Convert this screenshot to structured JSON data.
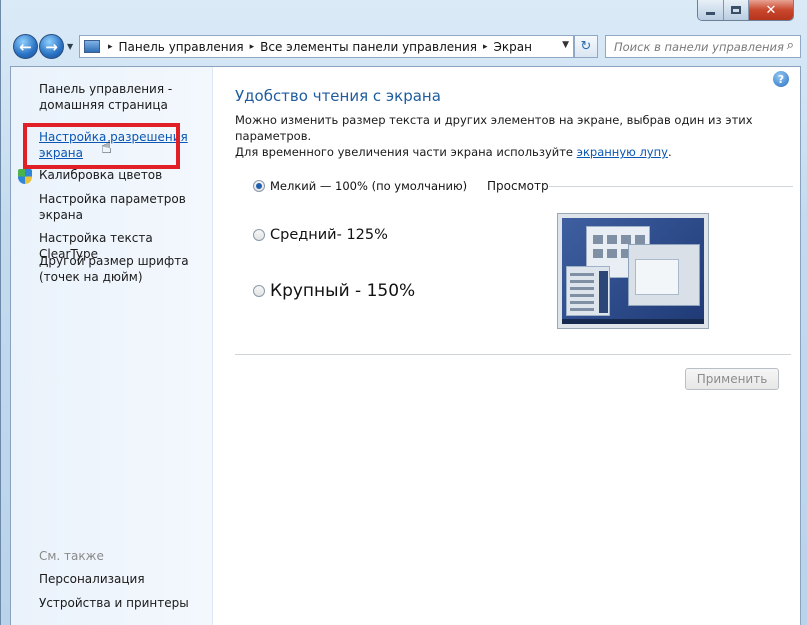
{
  "window": {
    "minimize_icon": "minimize-icon",
    "maximize_icon": "maximize-icon",
    "close_glyph": "✕"
  },
  "nav": {
    "back_glyph": "←",
    "forward_glyph": "→",
    "history_glyph": "▼",
    "breadcrumb": [
      "Панель управления",
      "Все элементы панели управления",
      "Экран"
    ],
    "breadcrumb_sep": "▸",
    "refresh_glyph": "↻",
    "search_placeholder": "Поиск в панели управления"
  },
  "sidebar": {
    "home_link": "Панель управления - домашняя страница",
    "items": [
      {
        "label": "Настройка разрешения экрана",
        "active": true
      },
      {
        "label": "Калибровка цветов"
      },
      {
        "label": "Настройка параметров экрана"
      },
      {
        "label": "Настройка текста ClearType"
      },
      {
        "label": "Другой размер шрифта (точек на дюйм)"
      }
    ],
    "see_also_title": "См. также",
    "see_also": [
      {
        "label": "Персонализация"
      },
      {
        "label": "Устройства и принтеры"
      }
    ]
  },
  "main": {
    "help_glyph": "?",
    "heading": "Удобство чтения с экрана",
    "desc_line1": "Можно изменить размер текста и других элементов на экране, выбрав один из этих параметров.",
    "desc_line2_prefix": "Для временного увеличения части экрана используйте ",
    "desc_link": "экранную лупу",
    "desc_line2_suffix": ".",
    "options": [
      {
        "label": "Мелкий — 100% (по умолчанию)",
        "selected": true
      },
      {
        "label": "Средний- 125%",
        "selected": false
      },
      {
        "label": "Крупный - 150%",
        "selected": false
      }
    ],
    "preview_label": "Просмотр",
    "apply_label": "Применить"
  },
  "colors": {
    "highlight_border": "#e11f26",
    "link": "#0a56b3",
    "heading": "#1d5c9f"
  }
}
